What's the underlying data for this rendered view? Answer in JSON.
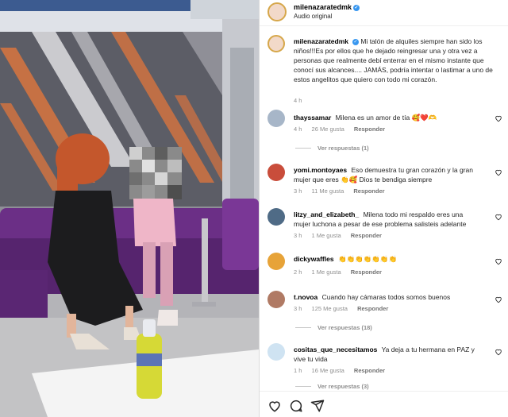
{
  "header": {
    "username": "milenazaratedmk",
    "subtitle": "Audio original"
  },
  "caption": {
    "username": "milenazaratedmk",
    "text": "Mi talón de alquiles siempre han sido los niños!!!Es por ellos que he dejado reingresar una y otra vez a personas que realmente debí enterrar en el mismo instante que conocí sus alcances.... JAMÁS, podría intentar o lastimar a uno de estos angelitos que quiero con todo mi corazón.",
    "time": "4 h"
  },
  "comments": [
    {
      "username": "thayssamar",
      "text": "Milena es un amor de tía 🥰❤️🫶",
      "time": "4 h",
      "likes": "26 Me gusta",
      "reply": "Responder",
      "replies": "Ver respuestas (1)",
      "avatar_color": "#a7b6c8"
    },
    {
      "username": "yomi.montoyaes",
      "text": "Eso demuestra tu gran corazón y la gran mujer que eres 👏🥰 Dios te bendiga siempre",
      "time": "3 h",
      "likes": "11 Me gusta",
      "reply": "Responder",
      "replies": "",
      "avatar_color": "#c94d3b"
    },
    {
      "username": "litzy_and_elizabeth_",
      "text": "Milena todo mi respaldo eres una mujer luchona a pesar de ese problema salisteis adelante",
      "time": "3 h",
      "likes": "1 Me gusta",
      "reply": "Responder",
      "replies": "",
      "avatar_color": "#4f6b86"
    },
    {
      "username": "dickywaffles",
      "text": "👏👏👏👏👏👏👏",
      "time": "2 h",
      "likes": "1 Me gusta",
      "reply": "Responder",
      "replies": "",
      "avatar_color": "#e7a338"
    },
    {
      "username": "t.novoa",
      "text": "Cuando hay cámaras todos somos buenos",
      "time": "3 h",
      "likes": "125 Me gusta",
      "reply": "Responder",
      "replies": "Ver respuestas (18)",
      "avatar_color": "#b07a64"
    },
    {
      "username": "cositas_que_necesitamos",
      "text": "Ya deja a tu hermana en PAZ y vive tu vida",
      "time": "1 h",
      "likes": "16 Me gusta",
      "reply": "Responder",
      "replies": "Ver respuestas (3)",
      "avatar_color": "#cfe3f2"
    }
  ],
  "icons": {
    "heart": "heart-icon",
    "comment": "comment-icon",
    "share": "share-icon",
    "verified": "verified-badge-icon"
  },
  "colors": {
    "accent": "#3897f0",
    "muted": "#8e8e8e",
    "sofa": "#6b2f86"
  }
}
